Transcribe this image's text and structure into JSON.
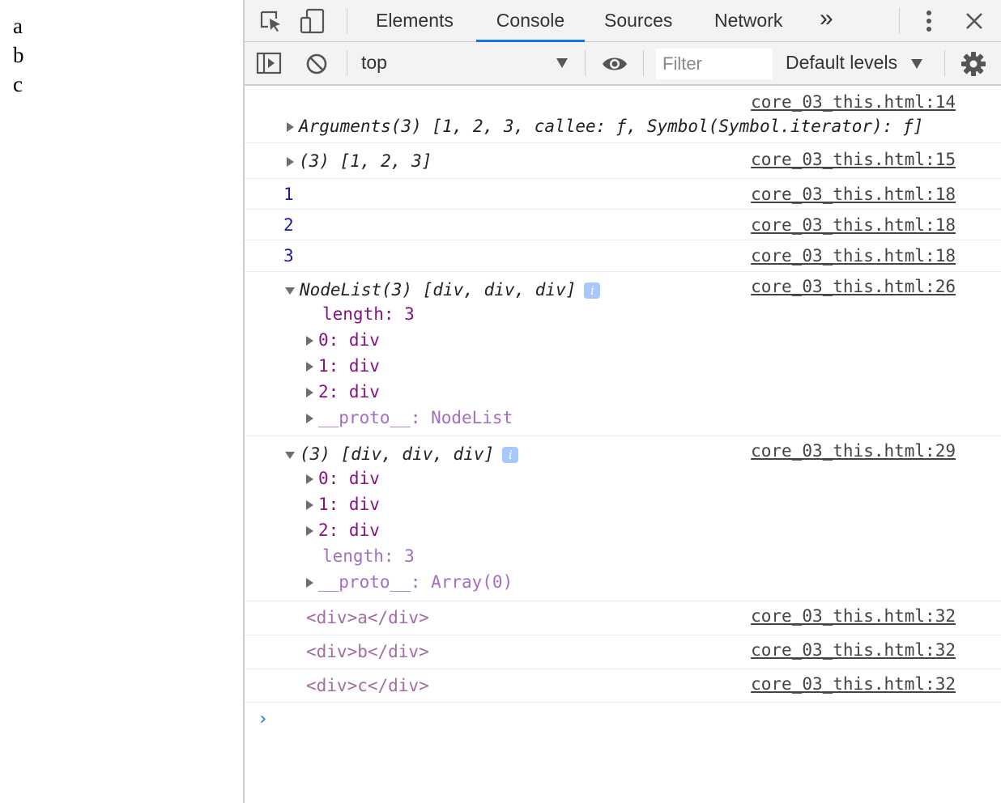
{
  "page": {
    "lines": [
      "a",
      "b",
      "c"
    ]
  },
  "devtools": {
    "tabs": [
      "Elements",
      "Console",
      "Sources",
      "Network"
    ],
    "more_tabs": "»",
    "active_tab": "Console",
    "context": "top",
    "filter_placeholder": "Filter",
    "levels": "Default levels",
    "accent": "#1a73e8"
  },
  "console": {
    "entries": [
      {
        "src": "core_03_this.html:14",
        "summary": "Arguments(3) [1, 2, 3, callee: ƒ, Symbol(Symbol.iterator): ƒ]"
      },
      {
        "src": "core_03_this.html:15",
        "summary": "(3) [1, 2, 3]"
      },
      {
        "src": "core_03_this.html:18",
        "value": "1"
      },
      {
        "src": "core_03_this.html:18",
        "value": "2"
      },
      {
        "src": "core_03_this.html:18",
        "value": "3"
      },
      {
        "src": "core_03_this.html:26",
        "summary": "NodeList(3) [div, div, div]",
        "props": [
          "length: 3",
          "0: div",
          "1: div",
          "2: div",
          "__proto__: NodeList"
        ]
      },
      {
        "src": "core_03_this.html:29",
        "summary": "(3) [div, div, div]",
        "props": [
          "0: div",
          "1: div",
          "2: div",
          "length: 3",
          "__proto__: Array(0)"
        ]
      },
      {
        "src": "core_03_this.html:32",
        "html": "<div>a</div>"
      },
      {
        "src": "core_03_this.html:32",
        "html": "<div>b</div>"
      },
      {
        "src": "core_03_this.html:32",
        "html": "<div>c</div>"
      }
    ],
    "prompt": "›"
  }
}
